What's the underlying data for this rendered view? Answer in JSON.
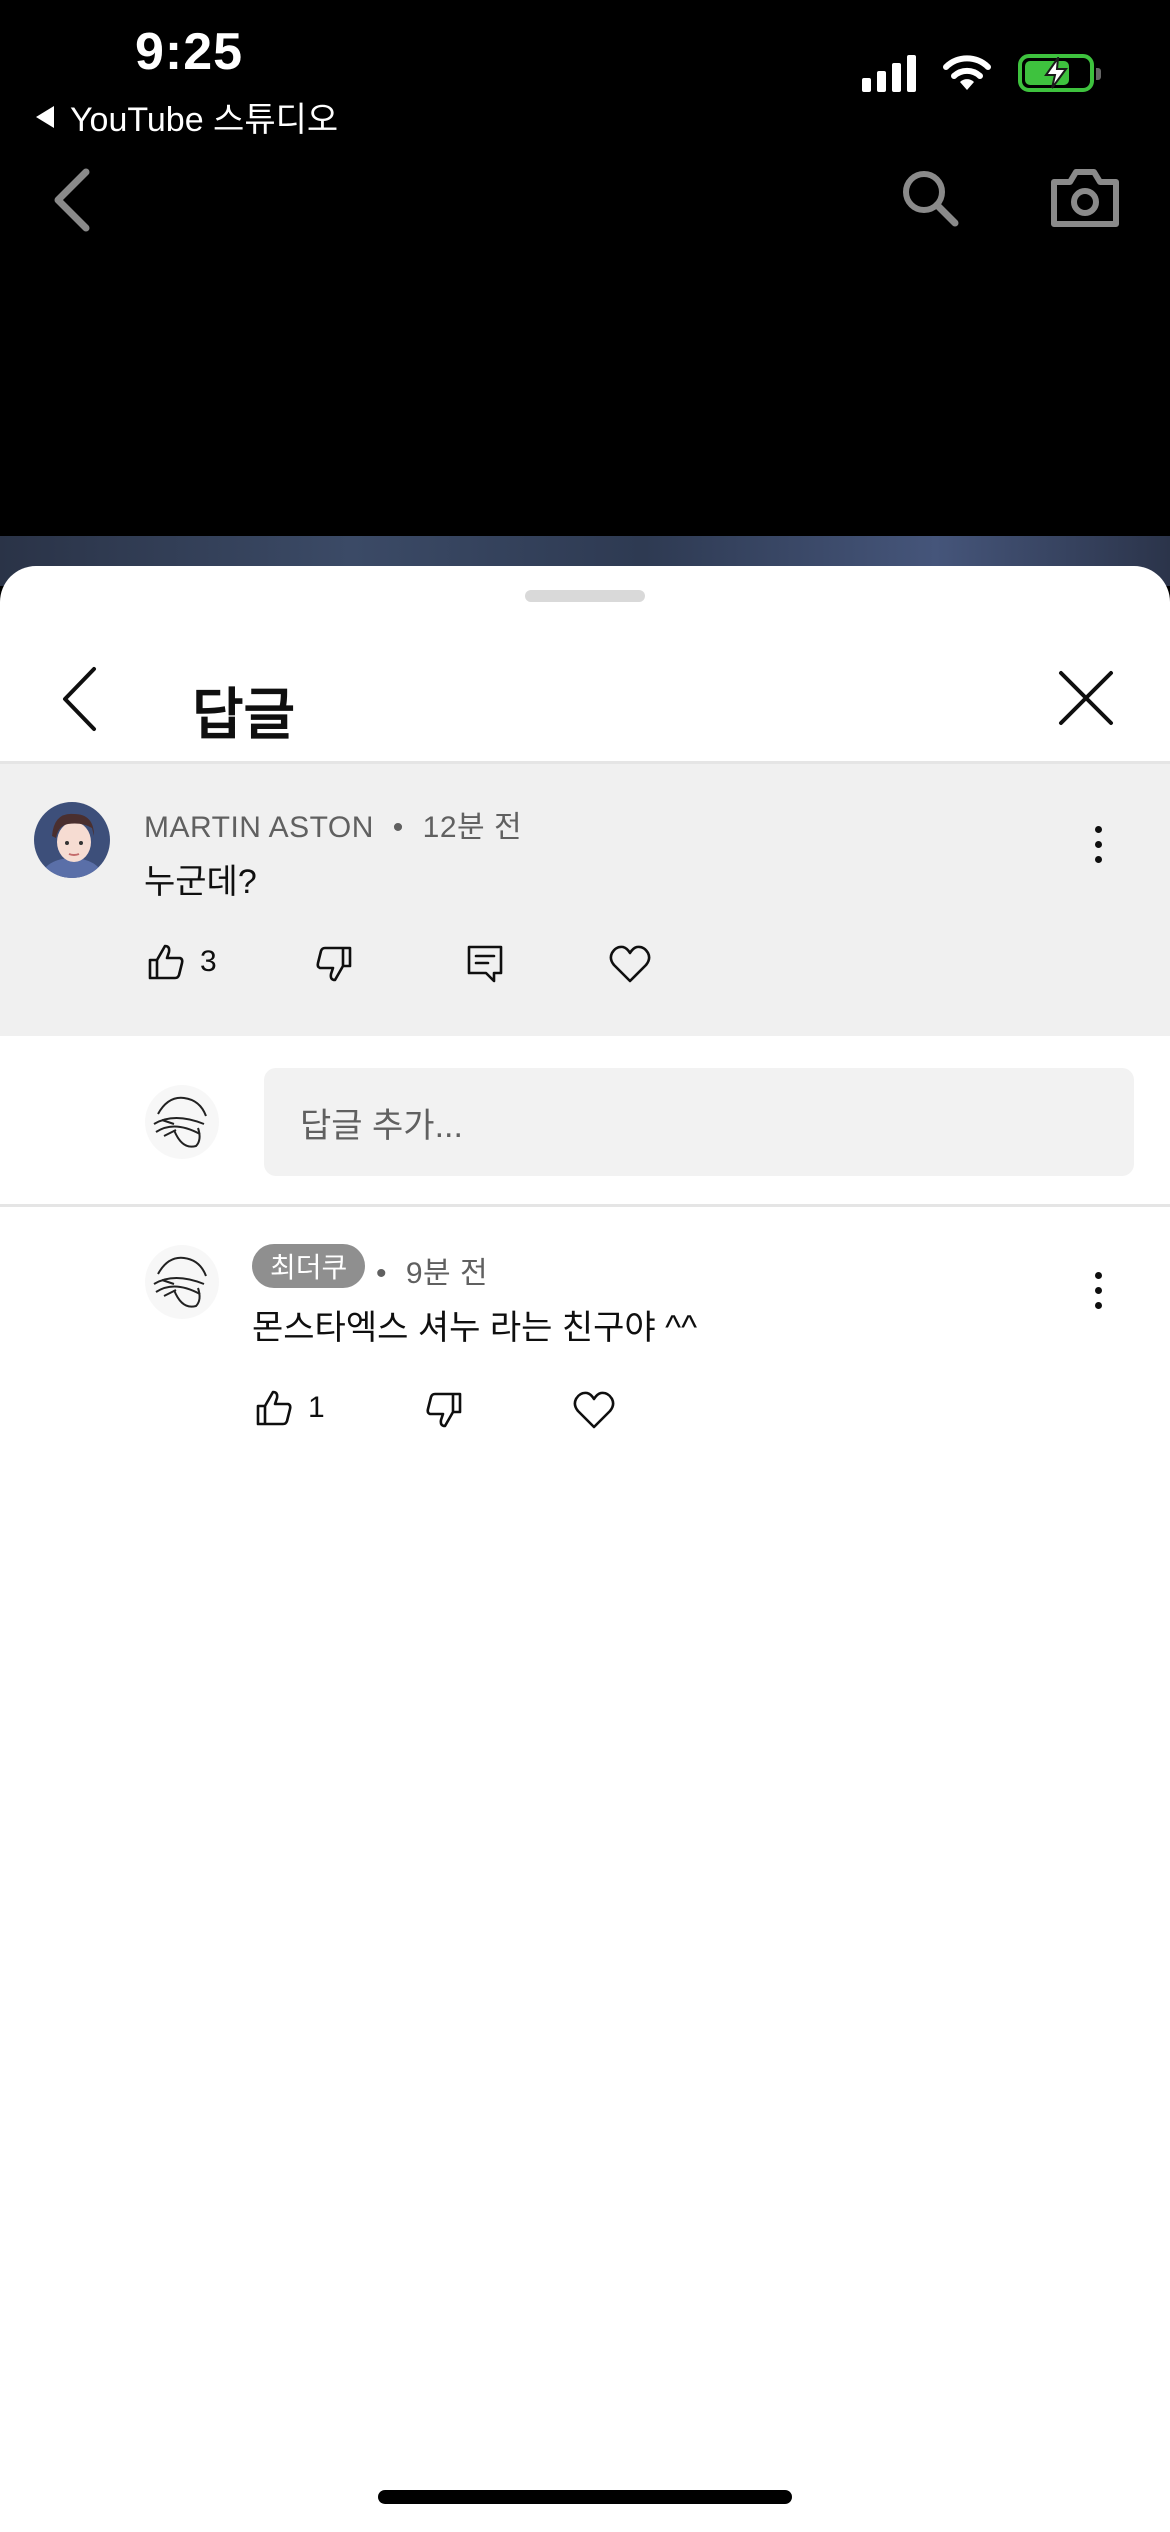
{
  "status_bar": {
    "time": "9:25",
    "back_app_label": "YouTube 스튜디오"
  },
  "video_nav": {
    "back_icon": "chevron-left-icon",
    "search_icon": "search-icon",
    "camera_icon": "camera-icon"
  },
  "sheet": {
    "title": "답글"
  },
  "parent_comment": {
    "author": "MARTIN ASTON",
    "separator": "•",
    "time": "12분 전",
    "text": "누군데?",
    "like_count": "3"
  },
  "reply_box": {
    "placeholder": "답글 추가..."
  },
  "replies": [
    {
      "author": "최더쿠",
      "separator": "•",
      "time": "9분 전",
      "text": "몬스타엑스 셔누 라는 친구야 ^^",
      "like_count": "1"
    }
  ],
  "colors": {
    "accent_battery": "#3ec23e",
    "parent_bg": "#f0f0f0",
    "badge_bg": "#8f8f8f"
  }
}
